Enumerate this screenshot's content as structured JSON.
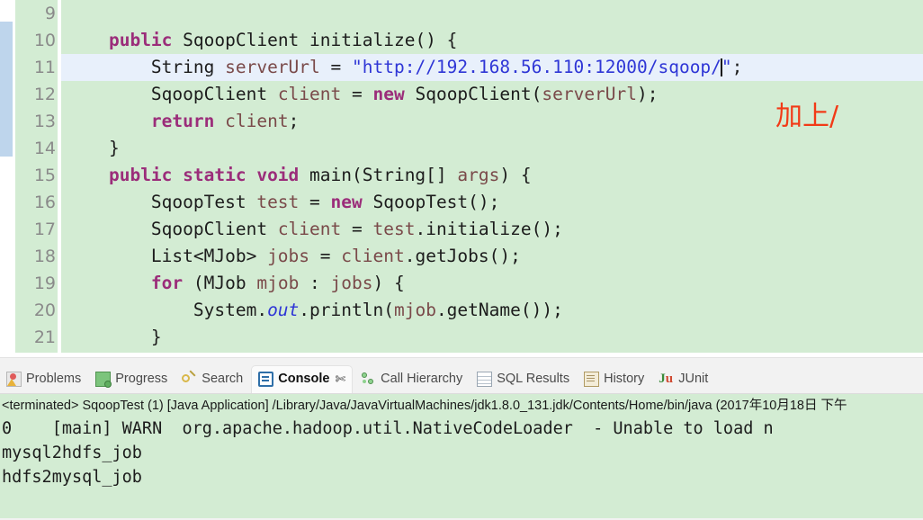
{
  "editor": {
    "name": "java-source-editor",
    "background": "#d3ecd3",
    "current_line_highlight": "#e8f0fb",
    "scope_bar_color": "#bed5ec",
    "lines": [
      {
        "number": "9",
        "fold": false,
        "current": false,
        "tokens": [
          {
            "t": "",
            "c": "plain"
          }
        ]
      },
      {
        "number": "10",
        "fold": true,
        "current": false,
        "tokens": [
          {
            "t": "    ",
            "c": "plain"
          },
          {
            "t": "public",
            "c": "kw"
          },
          {
            "t": " SqoopClient initialize() {",
            "c": "plain"
          }
        ]
      },
      {
        "number": "11",
        "fold": false,
        "current": true,
        "tokens": [
          {
            "t": "        String ",
            "c": "plain"
          },
          {
            "t": "serverUrl",
            "c": "fld"
          },
          {
            "t": " = ",
            "c": "plain"
          },
          {
            "t": "\"http://192.168.56.110:12000/sqoop/",
            "c": "str"
          },
          {
            "t": "|CARET|",
            "c": "caret"
          },
          {
            "t": "\"",
            "c": "str"
          },
          {
            "t": ";",
            "c": "plain"
          }
        ]
      },
      {
        "number": "12",
        "fold": false,
        "current": false,
        "tokens": [
          {
            "t": "        SqoopClient ",
            "c": "plain"
          },
          {
            "t": "client",
            "c": "fld"
          },
          {
            "t": " = ",
            "c": "plain"
          },
          {
            "t": "new",
            "c": "kw"
          },
          {
            "t": " SqoopClient(",
            "c": "plain"
          },
          {
            "t": "serverUrl",
            "c": "fld"
          },
          {
            "t": ");",
            "c": "plain"
          }
        ]
      },
      {
        "number": "13",
        "fold": false,
        "current": false,
        "tokens": [
          {
            "t": "        ",
            "c": "plain"
          },
          {
            "t": "return",
            "c": "kw"
          },
          {
            "t": " ",
            "c": "plain"
          },
          {
            "t": "client",
            "c": "fld"
          },
          {
            "t": ";",
            "c": "plain"
          }
        ]
      },
      {
        "number": "14",
        "fold": false,
        "current": false,
        "tokens": [
          {
            "t": "    }",
            "c": "plain"
          }
        ]
      },
      {
        "number": "15",
        "fold": true,
        "current": false,
        "tokens": [
          {
            "t": "    ",
            "c": "plain"
          },
          {
            "t": "public static void",
            "c": "kw"
          },
          {
            "t": " main(String[] ",
            "c": "plain"
          },
          {
            "t": "args",
            "c": "fld"
          },
          {
            "t": ") {",
            "c": "plain"
          }
        ]
      },
      {
        "number": "16",
        "fold": false,
        "current": false,
        "tokens": [
          {
            "t": "        SqoopTest ",
            "c": "plain"
          },
          {
            "t": "test",
            "c": "fld"
          },
          {
            "t": " = ",
            "c": "plain"
          },
          {
            "t": "new",
            "c": "kw"
          },
          {
            "t": " SqoopTest();",
            "c": "plain"
          }
        ]
      },
      {
        "number": "17",
        "fold": false,
        "current": false,
        "tokens": [
          {
            "t": "        SqoopClient ",
            "c": "plain"
          },
          {
            "t": "client",
            "c": "fld"
          },
          {
            "t": " = ",
            "c": "plain"
          },
          {
            "t": "test",
            "c": "fld"
          },
          {
            "t": ".initialize();",
            "c": "plain"
          }
        ]
      },
      {
        "number": "18",
        "fold": false,
        "current": false,
        "tokens": [
          {
            "t": "        List<MJob> ",
            "c": "plain"
          },
          {
            "t": "jobs",
            "c": "fld"
          },
          {
            "t": " = ",
            "c": "plain"
          },
          {
            "t": "client",
            "c": "fld"
          },
          {
            "t": ".getJobs();",
            "c": "plain"
          }
        ]
      },
      {
        "number": "19",
        "fold": false,
        "current": false,
        "tokens": [
          {
            "t": "        ",
            "c": "plain"
          },
          {
            "t": "for",
            "c": "kw"
          },
          {
            "t": " (MJob ",
            "c": "plain"
          },
          {
            "t": "mjob",
            "c": "fld"
          },
          {
            "t": " : ",
            "c": "plain"
          },
          {
            "t": "jobs",
            "c": "fld"
          },
          {
            "t": ") {",
            "c": "plain"
          }
        ]
      },
      {
        "number": "20",
        "fold": false,
        "current": false,
        "tokens": [
          {
            "t": "            System.",
            "c": "plain"
          },
          {
            "t": "out",
            "c": "stat"
          },
          {
            "t": ".println(",
            "c": "plain"
          },
          {
            "t": "mjob",
            "c": "fld"
          },
          {
            "t": ".getName());",
            "c": "plain"
          }
        ]
      },
      {
        "number": "21",
        "fold": false,
        "current": false,
        "tokens": [
          {
            "t": "        }",
            "c": "plain"
          }
        ]
      }
    ],
    "annotation": {
      "text": "加上/",
      "color": "#f23a17"
    }
  },
  "bottom_panel": {
    "tabs": [
      {
        "label": "Problems",
        "icon": "problems-icon",
        "icon_class": "ic-problems",
        "active": false,
        "closable": false
      },
      {
        "label": "Progress",
        "icon": "progress-icon",
        "icon_class": "ic-progress",
        "active": false,
        "closable": false
      },
      {
        "label": "Search",
        "icon": "search-icon",
        "icon_class": "ic-search",
        "active": false,
        "closable": false
      },
      {
        "label": "Console",
        "icon": "console-icon",
        "icon_class": "ic-console",
        "active": true,
        "closable": true,
        "close_glyph": "✄"
      },
      {
        "label": "Call Hierarchy",
        "icon": "call-hierarchy-icon",
        "icon_class": "ic-callhier",
        "active": false,
        "closable": false
      },
      {
        "label": "SQL Results",
        "icon": "sql-results-icon",
        "icon_class": "ic-sql",
        "active": false,
        "closable": false
      },
      {
        "label": "History",
        "icon": "history-icon",
        "icon_class": "ic-history",
        "active": false,
        "closable": false
      },
      {
        "label": "JUnit",
        "icon": "junit-icon",
        "icon_class": "ic-junit",
        "active": false,
        "closable": false
      }
    ],
    "console": {
      "terminated_line": "<terminated> SqoopTest (1) [Java Application] /Library/Java/JavaVirtualMachines/jdk1.8.0_131.jdk/Contents/Home/bin/java (2017年10月18日 下午",
      "output_lines": [
        "0    [main] WARN  org.apache.hadoop.util.NativeCodeLoader  - Unable to load n",
        "mysql2hdfs_job",
        "hdfs2mysql_job"
      ],
      "background": "#d3ecd3"
    }
  }
}
